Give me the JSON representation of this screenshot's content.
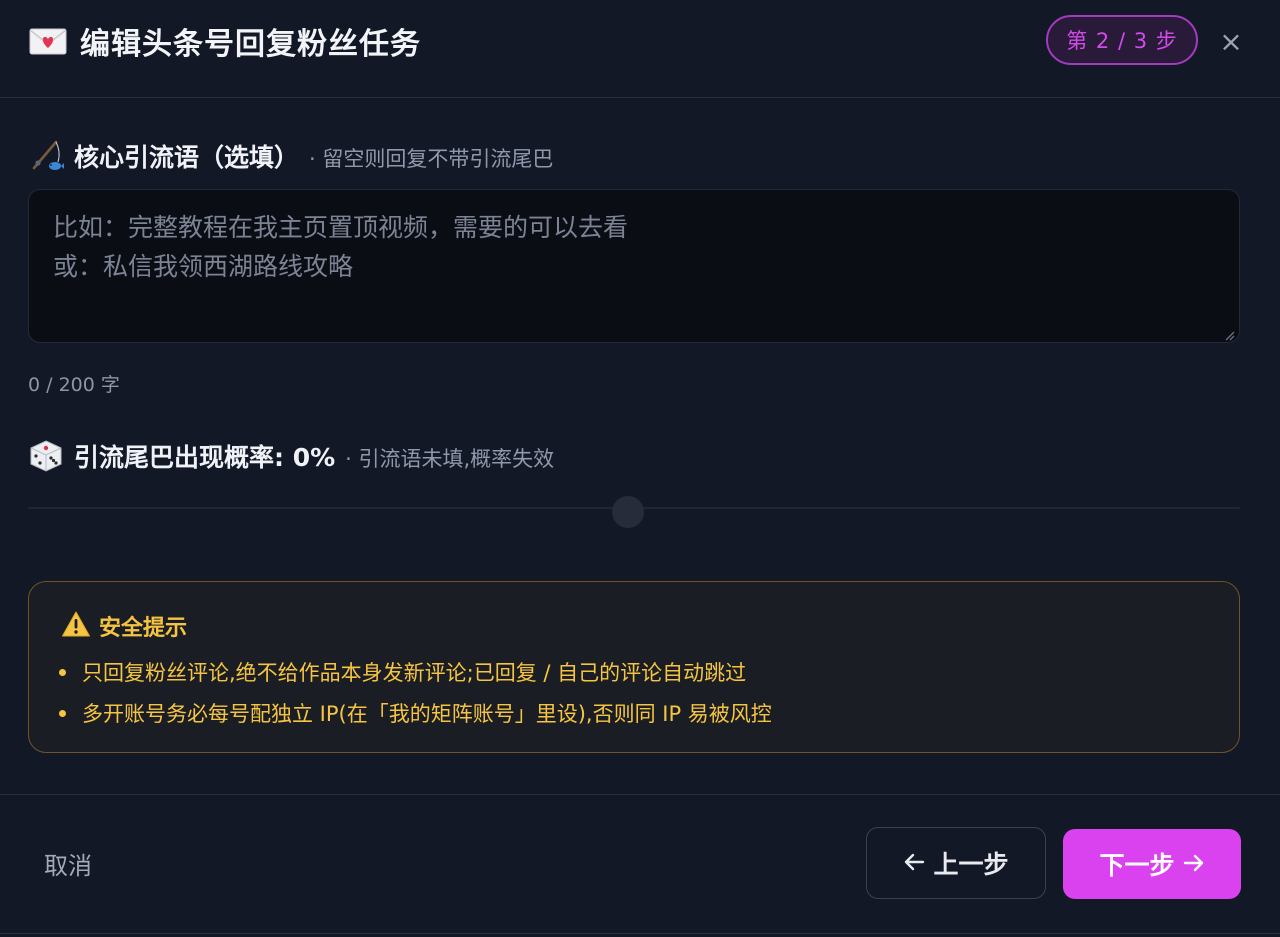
{
  "header": {
    "title": "编辑头条号回复粉丝任务",
    "title_icon": "love-letter-icon",
    "step_badge": "第 2 / 3 步",
    "close_label": "×"
  },
  "lead_phrase": {
    "icon": "fishing-pole-icon",
    "label": "核心引流语（选填）",
    "hint": "· 留空则回复不带引流尾巴",
    "value": "",
    "placeholder_lines": [
      "比如：完整教程在我主页置顶视频，需要的可以去看",
      "或：私信我领西湖路线攻略"
    ],
    "counter": "0 / 200 字"
  },
  "probability": {
    "icon": "dice-icon",
    "label": "引流尾巴出现概率: 0%",
    "hint": "· 引流语未填,概率失效",
    "value_percent": 0
  },
  "warning": {
    "icon": "warning-icon",
    "title": "安全提示",
    "items": [
      "只回复粉丝评论,绝不给作品本身发新评论;已回复 / 自己的评论自动跳过",
      "多开账号务必每号配独立 IP(在「我的矩阵账号」里设),否则同 IP 易被风控"
    ]
  },
  "footer": {
    "cancel_label": "取消",
    "prev_label": "上一步",
    "next_label": "下一步"
  },
  "colors": {
    "background": "#121826",
    "accent": "#d942ee",
    "warning": "#f5c542"
  }
}
